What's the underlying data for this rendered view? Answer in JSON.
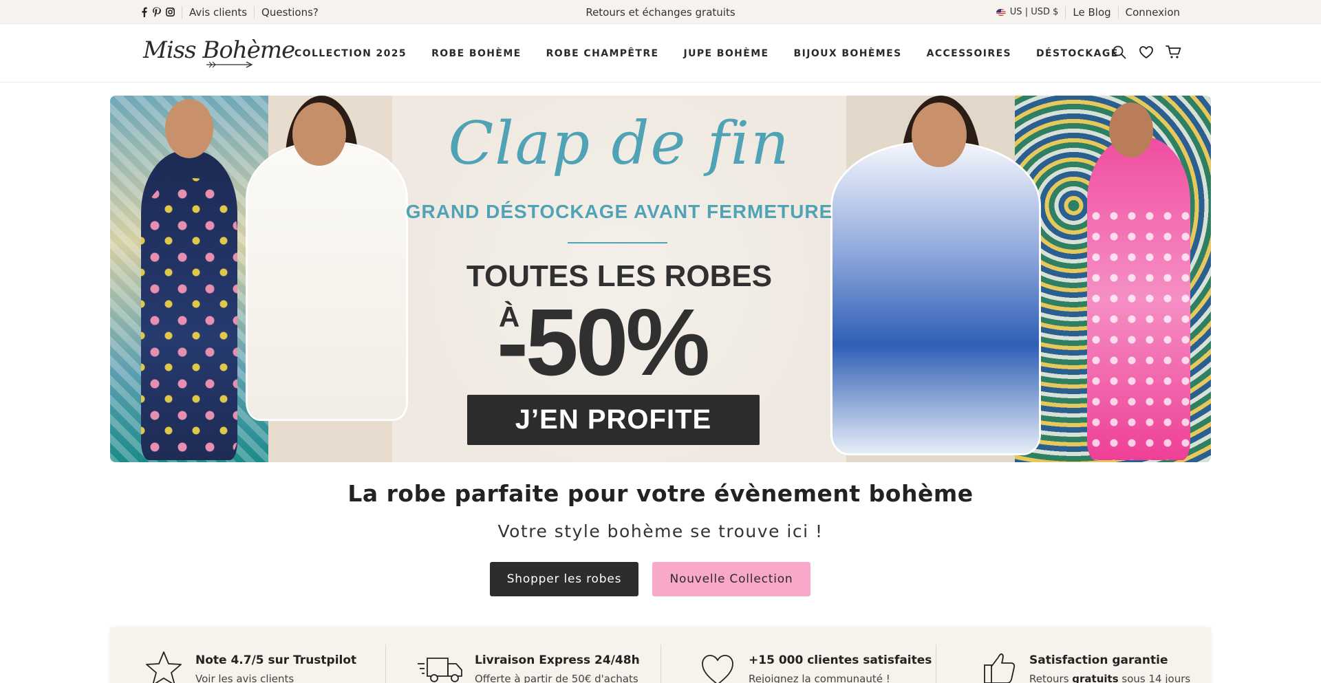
{
  "topbar": {
    "links": [
      "Avis clients",
      "Questions?"
    ],
    "announcement": "Retours et échanges gratuits",
    "currency": "US | USD $",
    "blog": "Le Blog",
    "login": "Connexion"
  },
  "header": {
    "logo": "Miss Bohème",
    "nav": [
      "COLLECTION 2025",
      "ROBE BOHÈME",
      "ROBE CHAMPÊTRE",
      "JUPE BOHÈME",
      "BIJOUX BOHÈMES",
      "ACCESSOIRES",
      "DÉSTOCKAGE"
    ]
  },
  "hero": {
    "script_title": "Clap de fin",
    "subtitle": "GRAND DÉSTOCKAGE AVANT FERMETURE",
    "line": "TOUTES LES ROBES",
    "prefix": "À",
    "discount": "-50%",
    "cta": "J’EN PROFITE"
  },
  "intro": {
    "headline": "La robe parfaite pour votre évènement bohème",
    "subline": "Votre style bohème se trouve ici !",
    "buttons": [
      "Shopper les robes",
      "Nouvelle Collection"
    ]
  },
  "features": [
    {
      "icon": "star-icon",
      "title": "Note 4.7/5 sur Trustpilot",
      "subtitle": "Voir les avis clients"
    },
    {
      "icon": "truck-icon",
      "title": "Livraison Express 24/48h",
      "subtitle": "Offerte à partir de 50€ d'achats"
    },
    {
      "icon": "heart-icon",
      "title": "+15 000 clientes satisfaites",
      "subtitle": "Rejoignez la communauté !"
    },
    {
      "icon": "thumbs-up-icon",
      "title": "Satisfaction garantie",
      "subtitle_before": "Retours ",
      "subtitle_bold": "gratuits",
      "subtitle_after": " sous 14 jours"
    }
  ],
  "colors": {
    "accent_teal": "#4fa3b5",
    "pink_button": "#f9a8c9",
    "dark_button": "#2d2d2d",
    "topbar_bg": "#f6f3ef"
  }
}
